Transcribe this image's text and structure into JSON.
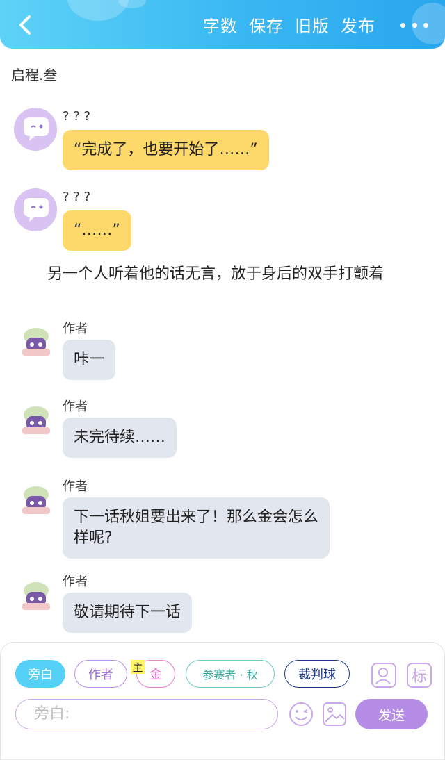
{
  "header": {
    "actions": [
      "字数",
      "保存",
      "旧版",
      "发布"
    ],
    "more_icon": "more-horizontal-icon",
    "back_icon": "chevron-left-icon",
    "accent": "#39b7f2"
  },
  "chapter_title": "启程.叁",
  "messages": [
    {
      "speaker": "? ? ?",
      "text": "“完成了，也要开始了……”",
      "style": "yellow"
    },
    {
      "speaker": "? ? ?",
      "text": "“……”",
      "style": "yellow"
    }
  ],
  "narration": "另一个人听着他的话无言，放于身后的双手打颤着",
  "author_messages": [
    {
      "speaker": "作者",
      "text": "咔一"
    },
    {
      "speaker": "作者",
      "text": "未完待续……"
    },
    {
      "speaker": "作者",
      "text": "下一话秋姐要出来了！那么金会怎么样呢?"
    },
    {
      "speaker": "作者",
      "text": "敬请期待下一话"
    }
  ],
  "roles": {
    "narrator": "旁白",
    "author": "作者",
    "main_tag": "主",
    "gold": "金",
    "contestant": "参赛者 · 秋",
    "referee": "裁判球"
  },
  "toolbar": {
    "mark_label": "标",
    "input_placeholder": "旁白:",
    "send_label": "发送"
  },
  "colors": {
    "yellow_bubble": "#fdd96b",
    "gray_bubble": "#e2e6ef",
    "send_button": "#b58de6",
    "narrator_chip": "#55d1f7"
  }
}
